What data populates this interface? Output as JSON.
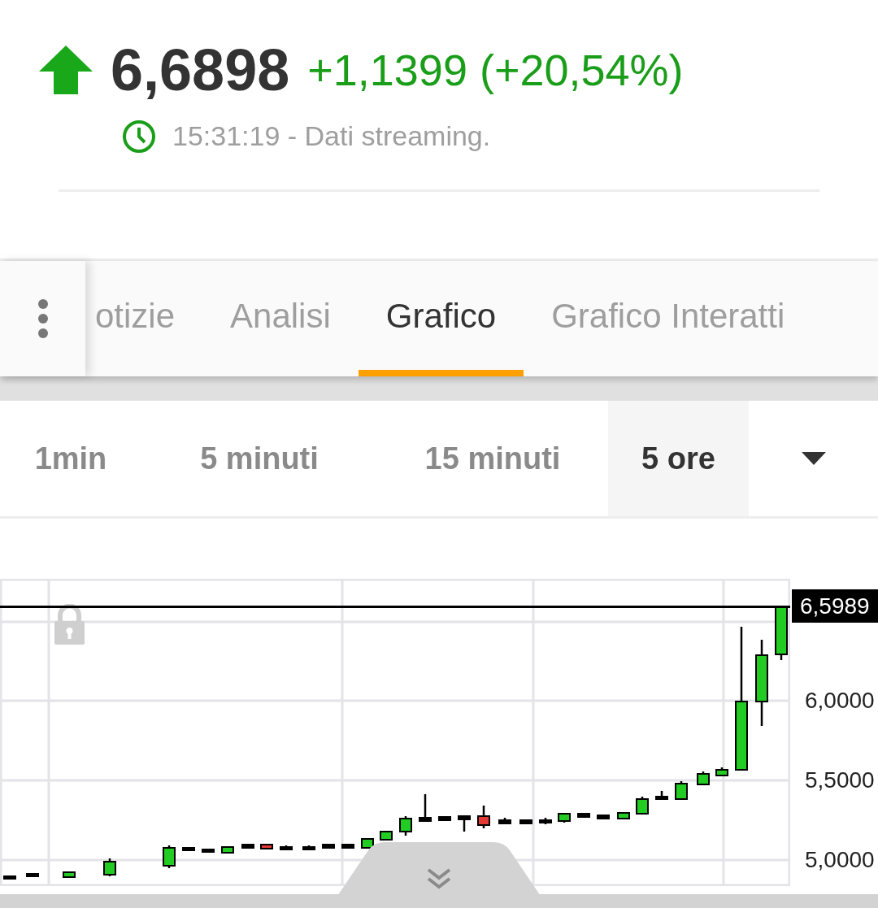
{
  "quote": {
    "rising": true,
    "price": "6,6898",
    "change": "+1,1399 (+20,54%)",
    "time_note": "15:31:19 - Dati streaming."
  },
  "tabs": [
    {
      "label": "otizie",
      "selected": false
    },
    {
      "label": "Analisi",
      "selected": false
    },
    {
      "label": "Grafico",
      "selected": true
    },
    {
      "label": "Grafico Interatti",
      "selected": false
    }
  ],
  "timeframes": [
    {
      "label": "1min",
      "selected": false
    },
    {
      "label": "5 minuti",
      "selected": false
    },
    {
      "label": "15 minuti",
      "selected": false
    },
    {
      "label": "5 ore",
      "selected": true
    }
  ],
  "chart": {
    "last_price": "6,5989",
    "y_labels": [
      "6,0000",
      "5,5000",
      "5,0000"
    ]
  }
}
